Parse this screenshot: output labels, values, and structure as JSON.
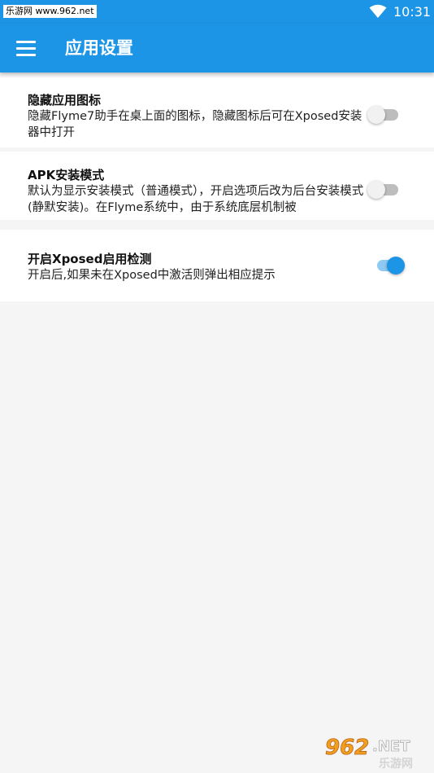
{
  "status_bar": {
    "watermark": "乐游网 www.962.net",
    "time": "10:31"
  },
  "app_bar": {
    "title": "应用设置"
  },
  "settings": [
    {
      "title": "隐藏应用图标",
      "description": "隐藏Flyme7助手在桌上面的图标，隐藏图标后可在Xposed安装器中打开",
      "enabled": false
    },
    {
      "title": "APK安装模式",
      "description": "默认为显示安装模式（普通模式），开启选项后改为后台安装模式(静默安装)。在Flyme系统中，由于系统底层机制被",
      "enabled": false
    },
    {
      "title": "开启Xposed启用检测",
      "description": "开启后,如果未在Xposed中激活则弹出相应提示",
      "enabled": true
    }
  ],
  "watermark_bottom": {
    "brand": "962",
    "suffix": ".NET",
    "name": "乐游网"
  },
  "colors": {
    "primary": "#1c95e6",
    "switch_on_track": "#8ec9f3",
    "switch_off_track": "#bdbdbd",
    "background": "#f5f5f5"
  }
}
